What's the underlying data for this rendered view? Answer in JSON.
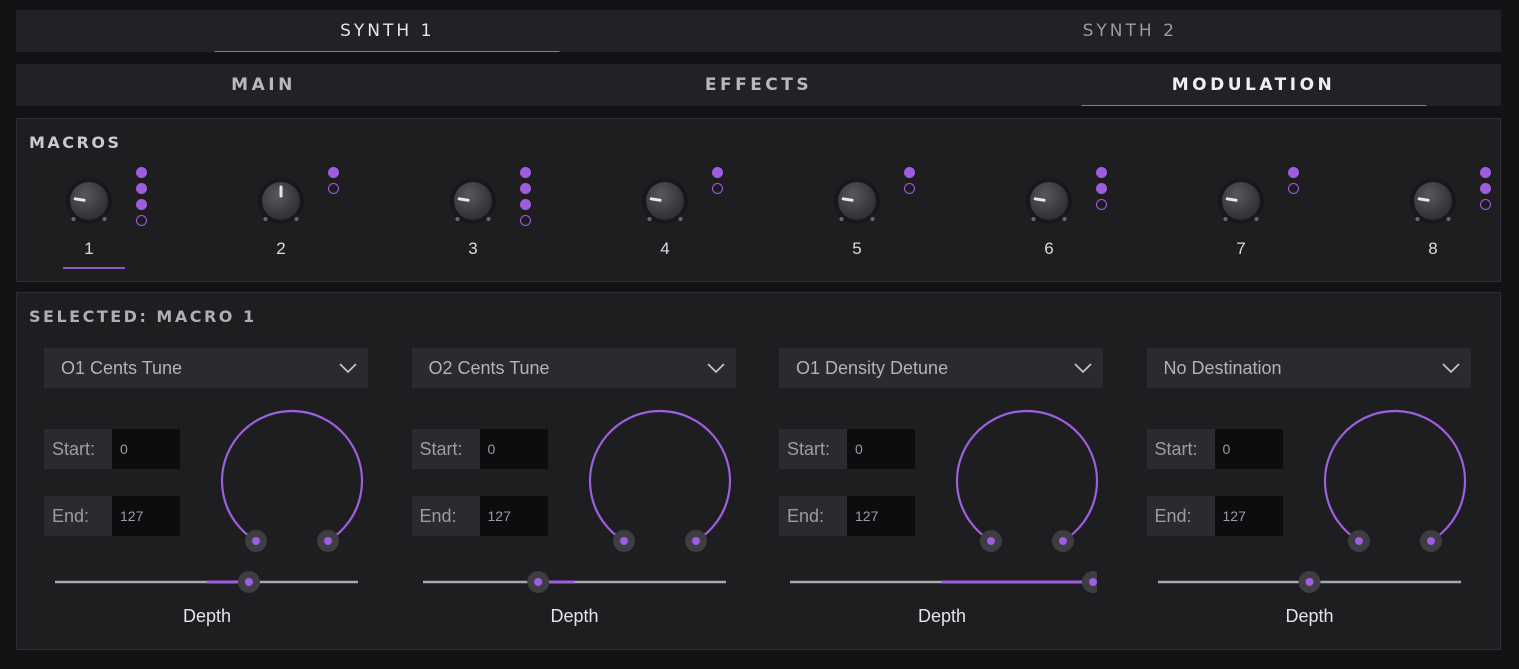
{
  "synth_tabs": [
    {
      "label": "SYNTH 1",
      "active": true
    },
    {
      "label": "SYNTH 2",
      "active": false
    }
  ],
  "section_tabs": [
    {
      "label": "MAIN",
      "active": false
    },
    {
      "label": "EFFECTS",
      "active": false
    },
    {
      "label": "MODULATION",
      "active": true
    }
  ],
  "macros": {
    "title": "MACROS",
    "items": [
      {
        "label": "1",
        "value": 0.2,
        "dots": [
          1,
          1,
          1,
          0
        ],
        "selected": true
      },
      {
        "label": "2",
        "value": 0.5,
        "dots": [
          1,
          0
        ],
        "selected": false
      },
      {
        "label": "3",
        "value": 0.2,
        "dots": [
          1,
          1,
          1,
          0
        ],
        "selected": false
      },
      {
        "label": "4",
        "value": 0.2,
        "dots": [
          1,
          0
        ],
        "selected": false
      },
      {
        "label": "5",
        "value": 0.2,
        "dots": [
          1,
          0
        ],
        "selected": false
      },
      {
        "label": "6",
        "value": 0.2,
        "dots": [
          1,
          1,
          0
        ],
        "selected": false
      },
      {
        "label": "7",
        "value": 0.2,
        "dots": [
          1,
          0
        ],
        "selected": false
      },
      {
        "label": "8",
        "value": 0.2,
        "dots": [
          1,
          1,
          0
        ],
        "selected": false
      }
    ]
  },
  "selected": {
    "title": "SELECTED: MACRO 1",
    "slots": [
      {
        "destination": "O1 Cents Tune",
        "start_label": "Start:",
        "start_value": "0",
        "end_label": "End:",
        "end_value": "127",
        "depth": 0.64,
        "depth_label": "Depth"
      },
      {
        "destination": "O2 Cents Tune",
        "start_label": "Start:",
        "start_value": "0",
        "end_label": "End:",
        "end_value": "127",
        "depth": 0.38,
        "depth_label": "Depth"
      },
      {
        "destination": "O1 Density Detune",
        "start_label": "Start:",
        "start_value": "0",
        "end_label": "End:",
        "end_value": "127",
        "depth": 1.0,
        "depth_label": "Depth"
      },
      {
        "destination": "No Destination",
        "start_label": "Start:",
        "start_value": "0",
        "end_label": "End:",
        "end_value": "127",
        "depth": 0.5,
        "depth_label": "Depth"
      }
    ]
  },
  "colors": {
    "accent": "#9d5fe0",
    "tab_underline": "#2e9fc9"
  }
}
